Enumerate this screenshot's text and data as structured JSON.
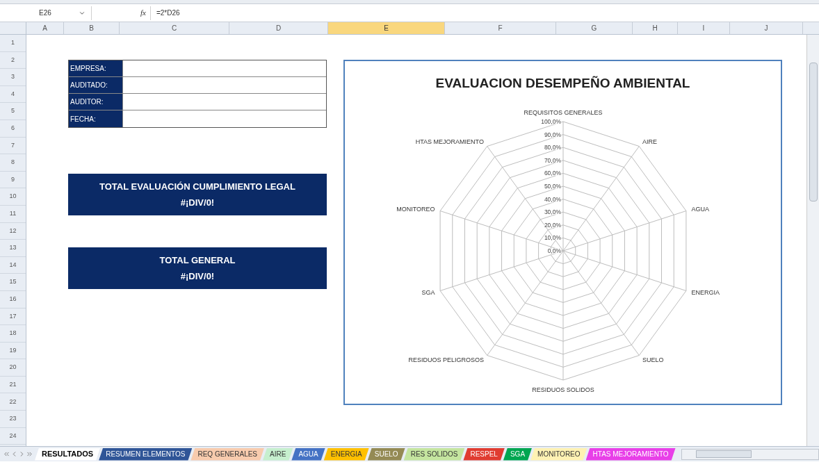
{
  "formula_bar": {
    "cell_ref": "E26",
    "function_label": "fx",
    "formula": "=2*D26"
  },
  "columns": [
    {
      "label": "A",
      "selected": false
    },
    {
      "label": "B",
      "selected": false
    },
    {
      "label": "C",
      "selected": false
    },
    {
      "label": "D",
      "selected": false
    },
    {
      "label": "E",
      "selected": true
    },
    {
      "label": "F",
      "selected": false
    },
    {
      "label": "G",
      "selected": false
    },
    {
      "label": "H",
      "selected": false
    },
    {
      "label": "I",
      "selected": false
    },
    {
      "label": "J",
      "selected": false
    }
  ],
  "rows": [
    "1",
    "2",
    "3",
    "4",
    "5",
    "6",
    "7",
    "8",
    "9",
    "10",
    "11",
    "12",
    "13",
    "14",
    "15",
    "16",
    "17",
    "18",
    "19",
    "20",
    "21",
    "22",
    "23",
    "24"
  ],
  "info_table": [
    {
      "label": "EMPRESA:"
    },
    {
      "label": "AUDITADO:"
    },
    {
      "label": "AUDITOR:"
    },
    {
      "label": "FECHA:"
    }
  ],
  "summaries": [
    {
      "title": "TOTAL EVALUACIÓN CUMPLIMIENTO LEGAL",
      "value": "#¡DIV/0!"
    },
    {
      "title": "TOTAL GENERAL",
      "value": "#¡DIV/0!"
    }
  ],
  "chart": {
    "title": "EVALUACION DESEMPEÑO AMBIENTAL",
    "axis_label_rows": [
      [
        "REQUISITOS GENERALES"
      ],
      [
        "HTAS MEJORAMIENTO",
        "AIRE"
      ],
      [
        "MONITOREO",
        "AGUA"
      ],
      [
        "SGA",
        "ENERGIA"
      ],
      [
        "RESIDUOS PELIGROSOS",
        "SUELO"
      ],
      [
        "RESIDUOS SOLIDOS"
      ]
    ],
    "ticks": [
      "100,0%",
      "90,0%",
      "80,0%",
      "70,0%",
      "60,0%",
      "50,0%",
      "40,0%",
      "30,0%",
      "20,0%",
      "10,0%",
      "0,0%"
    ]
  },
  "sheet_tabs": [
    {
      "label": "RESULTADOS",
      "selected": true,
      "color": "#ffffff"
    },
    {
      "label": "RESUMEN ELEMENTOS",
      "selected": false,
      "color": "#2f5597"
    },
    {
      "label": "REQ GENERALES",
      "selected": false,
      "color": "#f8cbad"
    },
    {
      "label": "AIRE",
      "selected": false,
      "color": "#c6efce"
    },
    {
      "label": "AGUA",
      "selected": false,
      "color": "#4472c4"
    },
    {
      "label": "ENERGIA",
      "selected": false,
      "color": "#ffc000"
    },
    {
      "label": "SUELO",
      "selected": false,
      "color": "#948a54"
    },
    {
      "label": "RES SOLIDOS",
      "selected": false,
      "color": "#c4e59f"
    },
    {
      "label": "RESPEL",
      "selected": false,
      "color": "#e03c31"
    },
    {
      "label": "SGA",
      "selected": false,
      "color": "#00a651"
    },
    {
      "label": "MONITOREO",
      "selected": false,
      "color": "#fff2b3"
    },
    {
      "label": "HTAS MEJORAMIENTO",
      "selected": false,
      "color": "#e83fe8"
    }
  ]
}
